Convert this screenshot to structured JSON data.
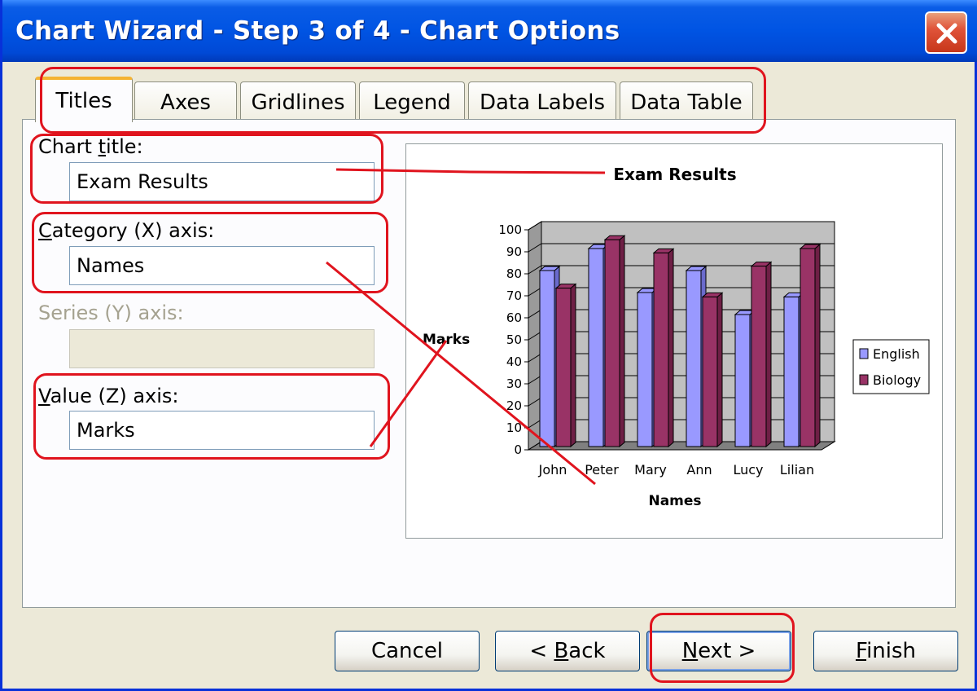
{
  "window": {
    "title": "Chart Wizard - Step 3 of 4 - Chart Options"
  },
  "tabs": [
    {
      "label": "Titles",
      "active": true
    },
    {
      "label": "Axes"
    },
    {
      "label": "Gridlines"
    },
    {
      "label": "Legend"
    },
    {
      "label": "Data Labels"
    },
    {
      "label": "Data Table"
    }
  ],
  "fields": {
    "chart_title": {
      "pre": "Chart ",
      "accel": "t",
      "post": "itle:",
      "value": "Exam Results"
    },
    "category_axis": {
      "pre": "",
      "accel": "C",
      "post": "ategory (X) axis:",
      "value": "Names"
    },
    "series_axis": {
      "label": "Series (Y) axis:",
      "value": ""
    },
    "value_axis": {
      "pre": "",
      "accel": "V",
      "post": "alue (Z) axis:",
      "value": "Marks"
    }
  },
  "buttons": {
    "cancel": {
      "label": "Cancel"
    },
    "back": {
      "pre": "< ",
      "accel": "B",
      "post": "ack"
    },
    "next": {
      "pre": "",
      "accel": "N",
      "post": "ext >"
    },
    "finish": {
      "pre": "",
      "accel": "F",
      "post": "inish"
    }
  },
  "colors": {
    "english": "#9999ff",
    "biology": "#993366",
    "annotation": "#e0141e",
    "titlebar": "#0054e3"
  },
  "chart_data": {
    "type": "bar",
    "title": "Exam Results",
    "xlabel": "Names",
    "ylabel": "Marks",
    "categories": [
      "John",
      "Peter",
      "Mary",
      "Ann",
      "Lucy",
      "Lilian"
    ],
    "series": [
      {
        "name": "English",
        "values": [
          80,
          90,
          70,
          80,
          60,
          68
        ]
      },
      {
        "name": "Biology",
        "values": [
          72,
          94,
          88,
          68,
          82,
          90
        ]
      }
    ],
    "ylim": [
      0,
      100
    ],
    "yticks": [
      "0",
      "10",
      "20",
      "30",
      "40",
      "50",
      "60",
      "70",
      "80",
      "90",
      "100"
    ],
    "grid": true,
    "legend": "right",
    "legend_labels": [
      "English",
      "Biology"
    ]
  }
}
